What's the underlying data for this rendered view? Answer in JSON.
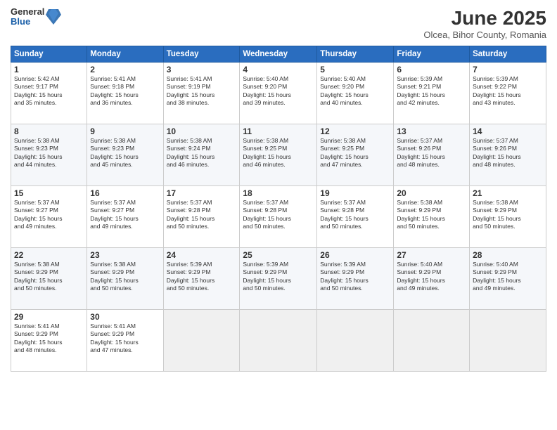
{
  "header": {
    "logo_general": "General",
    "logo_blue": "Blue",
    "month_title": "June 2025",
    "location": "Olcea, Bihor County, Romania"
  },
  "weekdays": [
    "Sunday",
    "Monday",
    "Tuesday",
    "Wednesday",
    "Thursday",
    "Friday",
    "Saturday"
  ],
  "weeks": [
    [
      {
        "day": "1",
        "info": "Sunrise: 5:42 AM\nSunset: 9:17 PM\nDaylight: 15 hours\nand 35 minutes."
      },
      {
        "day": "2",
        "info": "Sunrise: 5:41 AM\nSunset: 9:18 PM\nDaylight: 15 hours\nand 36 minutes."
      },
      {
        "day": "3",
        "info": "Sunrise: 5:41 AM\nSunset: 9:19 PM\nDaylight: 15 hours\nand 38 minutes."
      },
      {
        "day": "4",
        "info": "Sunrise: 5:40 AM\nSunset: 9:20 PM\nDaylight: 15 hours\nand 39 minutes."
      },
      {
        "day": "5",
        "info": "Sunrise: 5:40 AM\nSunset: 9:20 PM\nDaylight: 15 hours\nand 40 minutes."
      },
      {
        "day": "6",
        "info": "Sunrise: 5:39 AM\nSunset: 9:21 PM\nDaylight: 15 hours\nand 42 minutes."
      },
      {
        "day": "7",
        "info": "Sunrise: 5:39 AM\nSunset: 9:22 PM\nDaylight: 15 hours\nand 43 minutes."
      }
    ],
    [
      {
        "day": "8",
        "info": "Sunrise: 5:38 AM\nSunset: 9:23 PM\nDaylight: 15 hours\nand 44 minutes."
      },
      {
        "day": "9",
        "info": "Sunrise: 5:38 AM\nSunset: 9:23 PM\nDaylight: 15 hours\nand 45 minutes."
      },
      {
        "day": "10",
        "info": "Sunrise: 5:38 AM\nSunset: 9:24 PM\nDaylight: 15 hours\nand 46 minutes."
      },
      {
        "day": "11",
        "info": "Sunrise: 5:38 AM\nSunset: 9:25 PM\nDaylight: 15 hours\nand 46 minutes."
      },
      {
        "day": "12",
        "info": "Sunrise: 5:38 AM\nSunset: 9:25 PM\nDaylight: 15 hours\nand 47 minutes."
      },
      {
        "day": "13",
        "info": "Sunrise: 5:37 AM\nSunset: 9:26 PM\nDaylight: 15 hours\nand 48 minutes."
      },
      {
        "day": "14",
        "info": "Sunrise: 5:37 AM\nSunset: 9:26 PM\nDaylight: 15 hours\nand 48 minutes."
      }
    ],
    [
      {
        "day": "15",
        "info": "Sunrise: 5:37 AM\nSunset: 9:27 PM\nDaylight: 15 hours\nand 49 minutes."
      },
      {
        "day": "16",
        "info": "Sunrise: 5:37 AM\nSunset: 9:27 PM\nDaylight: 15 hours\nand 49 minutes."
      },
      {
        "day": "17",
        "info": "Sunrise: 5:37 AM\nSunset: 9:28 PM\nDaylight: 15 hours\nand 50 minutes."
      },
      {
        "day": "18",
        "info": "Sunrise: 5:37 AM\nSunset: 9:28 PM\nDaylight: 15 hours\nand 50 minutes."
      },
      {
        "day": "19",
        "info": "Sunrise: 5:37 AM\nSunset: 9:28 PM\nDaylight: 15 hours\nand 50 minutes."
      },
      {
        "day": "20",
        "info": "Sunrise: 5:38 AM\nSunset: 9:29 PM\nDaylight: 15 hours\nand 50 minutes."
      },
      {
        "day": "21",
        "info": "Sunrise: 5:38 AM\nSunset: 9:29 PM\nDaylight: 15 hours\nand 50 minutes."
      }
    ],
    [
      {
        "day": "22",
        "info": "Sunrise: 5:38 AM\nSunset: 9:29 PM\nDaylight: 15 hours\nand 50 minutes."
      },
      {
        "day": "23",
        "info": "Sunrise: 5:38 AM\nSunset: 9:29 PM\nDaylight: 15 hours\nand 50 minutes."
      },
      {
        "day": "24",
        "info": "Sunrise: 5:39 AM\nSunset: 9:29 PM\nDaylight: 15 hours\nand 50 minutes."
      },
      {
        "day": "25",
        "info": "Sunrise: 5:39 AM\nSunset: 9:29 PM\nDaylight: 15 hours\nand 50 minutes."
      },
      {
        "day": "26",
        "info": "Sunrise: 5:39 AM\nSunset: 9:29 PM\nDaylight: 15 hours\nand 50 minutes."
      },
      {
        "day": "27",
        "info": "Sunrise: 5:40 AM\nSunset: 9:29 PM\nDaylight: 15 hours\nand 49 minutes."
      },
      {
        "day": "28",
        "info": "Sunrise: 5:40 AM\nSunset: 9:29 PM\nDaylight: 15 hours\nand 49 minutes."
      }
    ],
    [
      {
        "day": "29",
        "info": "Sunrise: 5:41 AM\nSunset: 9:29 PM\nDaylight: 15 hours\nand 48 minutes."
      },
      {
        "day": "30",
        "info": "Sunrise: 5:41 AM\nSunset: 9:29 PM\nDaylight: 15 hours\nand 47 minutes."
      },
      {
        "day": "",
        "info": ""
      },
      {
        "day": "",
        "info": ""
      },
      {
        "day": "",
        "info": ""
      },
      {
        "day": "",
        "info": ""
      },
      {
        "day": "",
        "info": ""
      }
    ]
  ]
}
